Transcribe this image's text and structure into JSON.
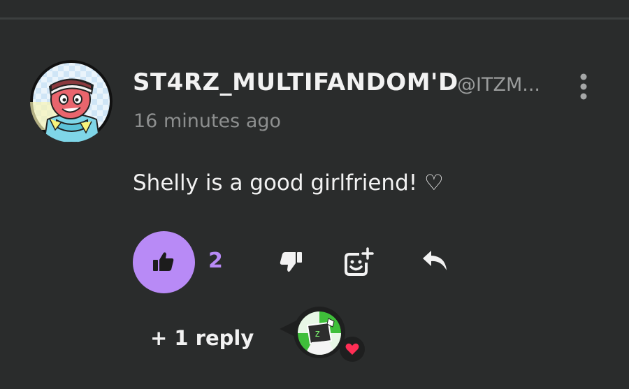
{
  "comment": {
    "username": "ST4RZ_MULTIFANDOM'D",
    "handle": "@ITZM...",
    "timestamp": "16 minutes ago",
    "text": "Shelly is a good girlfriend! ♡",
    "like_count": "2",
    "replies_label": "+ 1 reply"
  },
  "colors": {
    "background": "#2a2c2c",
    "accent": "#b88af6",
    "heart": "#ff2e55"
  },
  "icons": {
    "more": "more-vertical-icon",
    "like": "thumbs-up-icon",
    "dislike": "thumbs-down-icon",
    "emoji": "add-emoji-icon",
    "reply": "reply-icon",
    "heart": "heart-icon"
  }
}
